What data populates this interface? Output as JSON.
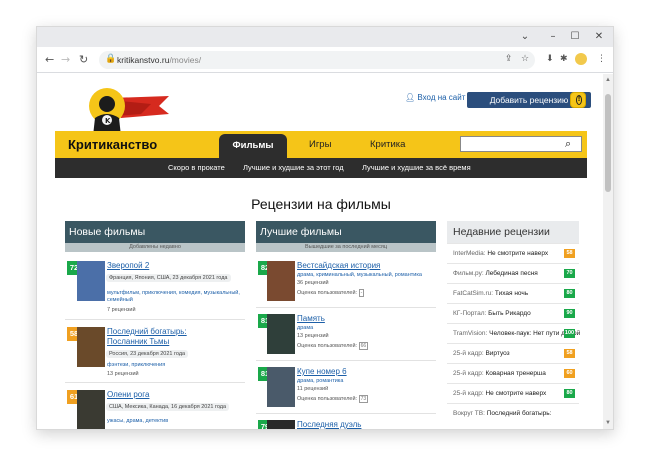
{
  "browser": {
    "url_host": "kritikanstvo.ru",
    "url_path": "/movies/"
  },
  "site": {
    "title": "Критиканство",
    "login_label": "Вход на сайт",
    "add_review_label": "Добавить рецензию",
    "alert_label": "!",
    "nav_tabs": [
      "Фильмы",
      "Игры",
      "Критика"
    ],
    "sub_links": [
      "Скоро в прокате",
      "Лучшие и худшие за этот год",
      "Лучшие и худшие за всё время"
    ]
  },
  "page_title": "Рецензии на фильмы",
  "new_films": {
    "heading": "Новые фильмы",
    "subheading": "Добавлены недавно",
    "items": [
      {
        "score": "72",
        "score_color": "#1aa84a",
        "title": "Зверопой 2",
        "title2": "",
        "meta": "Франция, Япония, США, 23 декабря 2021 года",
        "genres": "мультфильм, приключения, комедия, музыкальный, семейный",
        "count": "7 рецензий",
        "poster_color": "#4b6fa8"
      },
      {
        "score": "58",
        "score_color": "#f0a020",
        "title": "Последний богатырь:",
        "title2": "Посланник Тьмы",
        "meta": "Россия, 23 декабря 2021 года",
        "genres": "фэнтези, приключения",
        "count": "13 рецензий",
        "poster_color": "#6a4a2a"
      },
      {
        "score": "61",
        "score_color": "#f0a020",
        "title": "Олени рога",
        "title2": "",
        "meta": "США, Мексика, Канада, 16 декабря 2021 года",
        "genres": "ужасы, драма, детектив",
        "count": "",
        "poster_color": "#3a3a32"
      }
    ]
  },
  "best_films": {
    "heading": "Лучшие фильмы",
    "subheading": "Вышедшие за последний месяц",
    "items": [
      {
        "score": "82",
        "score_color": "#1aa84a",
        "title": "Вестсайдская история",
        "genres": "драма, криминальный, музыкальный, романтика",
        "count": "36 рецензий",
        "user_label": "Оценка пользователей:",
        "user_score": "-",
        "poster_color": "#7a4a30"
      },
      {
        "score": "81",
        "score_color": "#1aa84a",
        "title": "Память",
        "genres": "драма",
        "count": "13 рецензий",
        "user_label": "Оценка пользователей:",
        "user_score": "66",
        "poster_color": "#2f3f3a"
      },
      {
        "score": "81",
        "score_color": "#1aa84a",
        "title": "Купе номер 6",
        "genres": "драма, романтика",
        "count": "11 рецензий",
        "user_label": "Оценка пользователей:",
        "user_score": "73",
        "poster_color": "#4a5a6a"
      },
      {
        "score": "79",
        "score_color": "#1aa84a",
        "title": "Последняя дуэль",
        "genres": "",
        "count": "",
        "user_label": "",
        "user_score": "",
        "poster_color": "#2a2a2a"
      }
    ]
  },
  "recent_reviews": {
    "heading": "Недавние рецензии",
    "items": [
      {
        "source": "InterMedia:",
        "film": "Не смотрите наверх",
        "score": "58",
        "color": "#f0a020"
      },
      {
        "source": "Фильм.ру:",
        "film": "Лебединая песня",
        "score": "70",
        "color": "#1aa84a"
      },
      {
        "source": "FatCatSim.ru:",
        "film": "Тихая ночь",
        "score": "80",
        "color": "#1aa84a"
      },
      {
        "source": "КГ-Портал:",
        "film": "Быть Рикардо",
        "score": "90",
        "color": "#1aa84a"
      },
      {
        "source": "TramVision:",
        "film": "Человек-паук: Нет пути домой",
        "score": "100",
        "color": "#1aa84a"
      },
      {
        "source": "25-й кадр:",
        "film": "Виртуоз",
        "score": "58",
        "color": "#f0a020"
      },
      {
        "source": "25-й кадр:",
        "film": "Коварная тренерша",
        "score": "60",
        "color": "#f0a020"
      },
      {
        "source": "25-й кадр:",
        "film": "Не смотрите наверх",
        "score": "80",
        "color": "#1aa84a"
      },
      {
        "source": "Вокруг ТВ:",
        "film": "Последний богатырь:",
        "score": "",
        "color": "#1aa84a"
      }
    ]
  }
}
